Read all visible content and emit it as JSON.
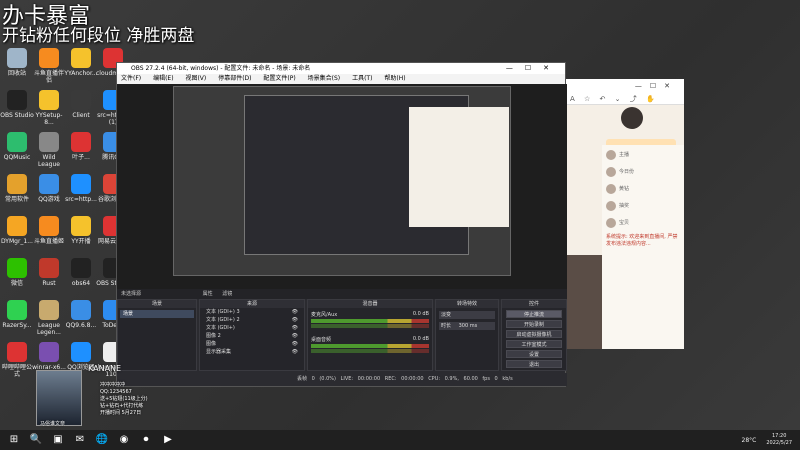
{
  "overlay": {
    "line1": "办卡暴富",
    "line2": "开钻粉任何段位 净胜两盘"
  },
  "desktop_icons": [
    {
      "label": "回收站",
      "color": "#9fb5c9"
    },
    {
      "label": "OBS Studio",
      "color": "#222"
    },
    {
      "label": "QQMusic",
      "color": "#2dbd6e"
    },
    {
      "label": "常用软件",
      "color": "#e4a12c"
    },
    {
      "label": "DYMgr_1...",
      "color": "#f5a623"
    },
    {
      "label": "微信",
      "color": "#2dc100"
    },
    {
      "label": "RazerSy...",
      "color": "#2fd151"
    },
    {
      "label": "哔哩哔哩公式",
      "color": "#d33"
    },
    {
      "label": "斗鱼直播伴侣",
      "color": "#f68b1f"
    },
    {
      "label": "YYSetup-8...",
      "color": "#f5c22c"
    },
    {
      "label": "Wild League",
      "color": "#888"
    },
    {
      "label": "QQ游戏",
      "color": "#3a8ee6"
    },
    {
      "label": "斗鱼直播姬",
      "color": "#f68b1f"
    },
    {
      "label": "Rust",
      "color": "#c0392b"
    },
    {
      "label": "League Legen...",
      "color": "#c8aa6e"
    },
    {
      "label": "winrar-x6...",
      "color": "#7a4fb0"
    },
    {
      "label": "YYAnchor...",
      "color": "#f5c22c"
    },
    {
      "label": "Client",
      "color": "#3a3a3a"
    },
    {
      "label": "叶子...",
      "color": "#d33"
    },
    {
      "label": "src=http...",
      "color": "#1e90ff"
    },
    {
      "label": "YY开播",
      "color": "#f5c22c"
    },
    {
      "label": "obs64",
      "color": "#222"
    },
    {
      "label": "QQ9.6.8...",
      "color": "#3a8ee6"
    },
    {
      "label": "QQ浏览器",
      "color": "#1e90ff"
    },
    {
      "label": "cloudmusi...",
      "color": "#d33"
    },
    {
      "label": "src=http...(1)",
      "color": "#1e90ff"
    },
    {
      "label": "腾讯QQ",
      "color": "#3a8ee6"
    },
    {
      "label": "谷歌浏览器",
      "color": "#db4437"
    },
    {
      "label": "网易云音乐",
      "color": "#d33"
    },
    {
      "label": "OBS Studio",
      "color": "#222"
    },
    {
      "label": "ToDesk",
      "color": "#2d8cf0"
    },
    {
      "label": "kanna插件 1109",
      "color": "#eee"
    }
  ],
  "obs": {
    "title": "OBS 27.2.4 (64-bit, windows) - 配置文件: 未命名 - 场景: 未命名",
    "menu": [
      "文件(F)",
      "编辑(E)",
      "视图(V)",
      "停靠部件(D)",
      "配置文件(P)",
      "场景集合(S)",
      "工具(T)",
      "帮助(H)"
    ],
    "scene_line": "未选择源",
    "tools_labels": [
      "属性",
      "滤镜"
    ],
    "docks": {
      "scenes": "场景",
      "sources": "来源",
      "mixer": "混音器",
      "transitions": "转场特效",
      "controls": "控件"
    },
    "scenes": [
      "场景"
    ],
    "sources": [
      {
        "name": "文本 (GDI+) 3",
        "eye": "👁",
        "lock": "🔓"
      },
      {
        "name": "文本 (GDI+) 2",
        "eye": "👁",
        "lock": "🔓"
      },
      {
        "name": "文本 (GDI+)",
        "eye": "👁",
        "lock": "🔓"
      },
      {
        "name": "图像 2",
        "eye": "👁",
        "lock": "🔓"
      },
      {
        "name": "图像",
        "eye": "👁",
        "lock": "🔓"
      },
      {
        "name": "显示器采集",
        "eye": "👁",
        "lock": "🔓"
      }
    ],
    "mixer": [
      {
        "name": "麦克风/Aux",
        "db": "0.0 dB"
      },
      {
        "name": "桌面音频",
        "db": "0.0 dB"
      }
    ],
    "transition": {
      "type": "淡变",
      "duration_label": "时长",
      "duration": "300 ms"
    },
    "controls": [
      "停止推流",
      "开始录制",
      "启动虚拟摄像机",
      "工作室模式",
      "设置",
      "退出"
    ],
    "status": {
      "lost": "丢帧 0 (0.0%)",
      "live": "LIVE: 00:00:00",
      "rec": "REC: 00:00:00",
      "cpu": "CPU: 0.9%, 60.00 fps",
      "kbps": "0 kb/s"
    }
  },
  "streamer": {
    "name": "KANANE",
    "label": "马俗谁文奈",
    "info": [
      "冲冲冲冲冲",
      "QQ:1234567",
      "送+5钻翅(11级上分)",
      "钻+钻石+代打代练",
      "开播时间 5月27日"
    ]
  },
  "browser": {
    "tools": [
      "A",
      "☆",
      "↶",
      "⌄",
      "⤴",
      "✋"
    ],
    "notice": "系统提示: 欢迎来到直播间, 严禁发布违法违规内容...",
    "chats": [
      "主播",
      "今日份",
      "黄钻",
      "抽奖",
      "宝贝"
    ]
  },
  "taskbar": {
    "weather": "28°C",
    "time": "17:20",
    "date": "2022/5/27",
    "icons": [
      "⊞",
      "🔍",
      "▣",
      "✉",
      "🌐",
      "◉",
      "⏺",
      "▶"
    ]
  }
}
